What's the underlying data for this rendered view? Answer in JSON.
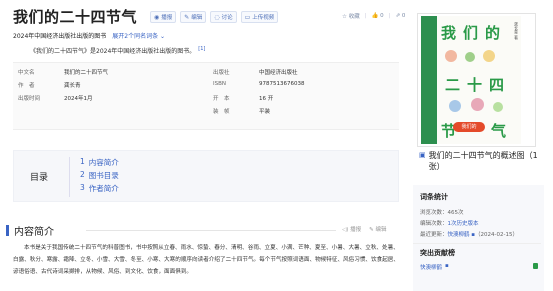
{
  "header": {
    "title": "我们的二十四节气",
    "actions": [
      {
        "icon": "play-icon",
        "label": "播报"
      },
      {
        "icon": "edit-icon",
        "label": "编辑"
      },
      {
        "icon": "comment-icon",
        "label": "讨论"
      },
      {
        "icon": "video-icon",
        "label": "上传视频"
      }
    ],
    "favorite": "收藏",
    "likes": "0",
    "shares": "0"
  },
  "subtitle": {
    "text": "2024年中国经济出版社出版的图书",
    "expand_link": "展开2个同名词条"
  },
  "summary": {
    "text": "《我们的二十四节气》是2024年中国经济出版社出版的图书。",
    "ref": "[1]"
  },
  "basic_info": {
    "left": [
      {
        "key": "中文名",
        "value": "我们的二十四节气"
      },
      {
        "key": "作　者",
        "value": "龚长青"
      },
      {
        "key": "出版时间",
        "value": "2024年1月"
      }
    ],
    "right": [
      {
        "key": "出版社",
        "value": "中国经济出版社"
      },
      {
        "key": "ISBN",
        "value": "9787513676038"
      },
      {
        "key": "开　本",
        "value": "16 开"
      },
      {
        "key": "装　帧",
        "value": "平装"
      }
    ]
  },
  "toc": {
    "label": "目录",
    "items": [
      {
        "num": "1",
        "label": "内容简介"
      },
      {
        "num": "2",
        "label": "图书目录"
      },
      {
        "num": "3",
        "label": "作者简介"
      }
    ]
  },
  "section": {
    "title": "内容简介",
    "play_label": "播报",
    "edit_label": "编辑",
    "body": "本书是关于我国传统二十四节气的科普图书，书中按照从立春、雨水、惊蛰、春分、清明、谷雨、立夏、小满、芒种、夏至、小暑、大暑、立秋、处暑、白露、秋分、寒露、霜降、立冬、小雪、大雪、冬至、小寒、大寒的顺序向读者介绍了二十四节气。每个节气按照词语面、物候特征、风俗习惯、饮食起居、谚语俗语、古代诗词采撷排，从物候、风俗、到文化、饮食，面面俱到。"
  },
  "cover": {
    "title_chars": [
      "我",
      "们",
      "的",
      "二",
      "十",
      "四",
      "节",
      "气"
    ],
    "author_side": "龚长青 著",
    "band": "我们的"
  },
  "sidebar": {
    "caption": "我们的二十四节气的概述图（1张）",
    "stats_title": "词条统计",
    "stats": [
      {
        "key": "浏览次数：",
        "value": "465次"
      },
      {
        "key": "编辑次数：",
        "value": "1次历史版本"
      },
      {
        "key": "最近更新：",
        "value": "快澳柳鹤",
        "extra": "（2024-02-15）"
      }
    ],
    "contrib_title": "突出贡献榜",
    "contrib_user": "快澳柳鹤"
  },
  "colors": {
    "accent": "#3a64c4",
    "cover_green": "#2a9a48"
  }
}
